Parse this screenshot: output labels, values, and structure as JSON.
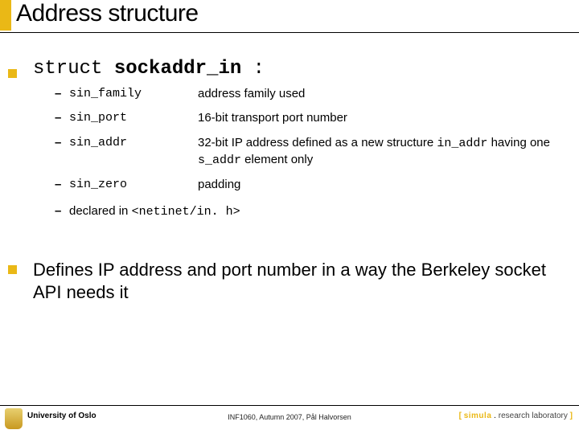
{
  "title": "Address structure",
  "main_item": {
    "prefix": "struct ",
    "name": "sockaddr_in",
    "suffix": " :"
  },
  "fields": [
    {
      "term": "sin_family",
      "desc_parts": [
        {
          "t": "address family used",
          "c": false
        }
      ]
    },
    {
      "term": "sin_port",
      "desc_parts": [
        {
          "t": "16-bit transport port number",
          "c": false
        }
      ]
    },
    {
      "term": "sin_addr",
      "desc_parts": [
        {
          "t": "32-bit IP address defined as a new structure ",
          "c": false
        },
        {
          "t": "in_addr",
          "c": true
        },
        {
          "t": " having one ",
          "c": false
        },
        {
          "t": "s_addr",
          "c": true
        },
        {
          "t": " element only",
          "c": false
        }
      ]
    },
    {
      "term": "sin_zero",
      "desc_parts": [
        {
          "t": "padding",
          "c": false
        }
      ]
    }
  ],
  "declared": {
    "label": "declared in ",
    "path": "<netinet/in. h>"
  },
  "second": "Defines IP address and port number in a way the Berkeley socket API needs it",
  "footer": {
    "left": "University of Oslo",
    "center": "INF1060, Autumn 2007, Pål Halvorsen",
    "right": {
      "open": "[ ",
      "sim": "simula",
      "dot": " . ",
      "rl": "research laboratory",
      "close": " ]"
    }
  }
}
